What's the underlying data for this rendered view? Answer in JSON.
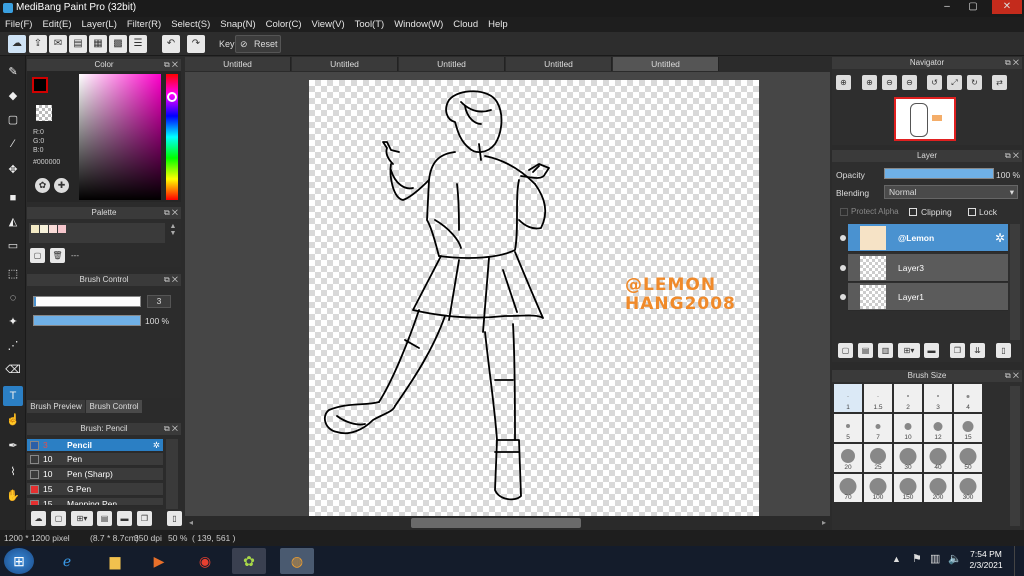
{
  "window": {
    "title": "MediBang Paint Pro (32bit)",
    "min": "–",
    "max": "▢",
    "close": "✕"
  },
  "menu": [
    "File(F)",
    "Edit(E)",
    "Layer(L)",
    "Filter(R)",
    "Select(S)",
    "Snap(N)",
    "Color(C)",
    "View(V)",
    "Tool(T)",
    "Window(W)",
    "Cloud",
    "Help"
  ],
  "toolbar": {
    "key_label": "Key",
    "reset_label": "Reset"
  },
  "color_panel": {
    "title": "Color",
    "r": "R:0",
    "g": "G:0",
    "b": "B:0",
    "hex": "#000000",
    "primary": "#000000",
    "accent_red": "#d00000"
  },
  "palette_panel": {
    "title": "Palette",
    "value": "---",
    "swatches": [
      "#f3e9c4",
      "#f7f1da",
      "#f9dcd8",
      "#f6c6cc"
    ]
  },
  "brush_control": {
    "title": "Brush Control",
    "size": "3",
    "opacity": "100 %",
    "opacity_fraction": 1.0
  },
  "brush_tabs": {
    "preview": "Brush Preview",
    "control": "Brush Control"
  },
  "brush_list": {
    "title": "Brush: Pencil",
    "items": [
      {
        "num": "3",
        "name": "Pencil",
        "swatch": "#2a5fa8"
      },
      {
        "num": "10",
        "name": "Pen",
        "swatch": "#3a3a3a"
      },
      {
        "num": "10",
        "name": "Pen (Sharp)",
        "swatch": "#3a3a3a"
      },
      {
        "num": "15",
        "name": "G Pen",
        "swatch": "#e53030"
      },
      {
        "num": "15",
        "name": "Mapping Pen",
        "swatch": "#e53030"
      }
    ]
  },
  "doc_tabs": [
    "Untitled",
    "Untitled",
    "Untitled",
    "Untitled",
    "Untitled"
  ],
  "watermark": {
    "line1": "@LEMON",
    "line2": "HANG2008",
    "color": "#f08a2a"
  },
  "navigator": {
    "title": "Navigator"
  },
  "layer_panel": {
    "title": "Layer",
    "opacity_label": "Opacity",
    "opacity_value": "100 %",
    "blending_label": "Blending",
    "blending_value": "Normal",
    "protect_alpha": "Protect Alpha",
    "clipping": "Clipping",
    "lock": "Lock",
    "layers": [
      "@Lemon",
      "Layer3",
      "Layer1"
    ]
  },
  "brush_size": {
    "title": "Brush Size",
    "sizes": [
      "1",
      "1.5",
      "2",
      "3",
      "4",
      "5",
      "7",
      "10",
      "12",
      "15",
      "20",
      "25",
      "30",
      "40",
      "50",
      "70",
      "100",
      "150",
      "200",
      "300"
    ]
  },
  "status": {
    "size": "1200 * 1200 pixel",
    "physical": "(8.7 * 8.7cm)",
    "dpi": "350 dpi",
    "zoom": "50 %",
    "coords": "( 139, 561 )"
  },
  "taskbar": {
    "time": "7:54 PM",
    "date": "2/3/2021"
  }
}
